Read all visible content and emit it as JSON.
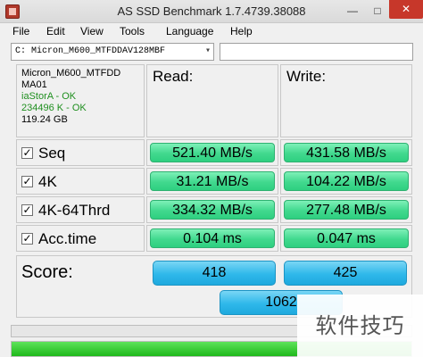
{
  "window": {
    "title": "AS SSD Benchmark 1.7.4739.38088",
    "minimize_glyph": "—",
    "maximize_glyph": "□",
    "close_glyph": "✕"
  },
  "menu": [
    "File",
    "Edit",
    "View",
    "Tools",
    "Language",
    "Help"
  ],
  "drive_select": {
    "value": "C: Micron_M600_MTFDDAV128MBF",
    "arrow": "▾"
  },
  "drive_info": {
    "model": "Micron_M600_MTFDD",
    "firmware": "MA01",
    "driver": "iaStorA - OK",
    "alignment": "234496 K - OK",
    "size": "119.24 GB"
  },
  "columns": {
    "read": "Read:",
    "write": "Write:"
  },
  "check_glyph": "✓",
  "rows": [
    {
      "label": "Seq",
      "read": "521.40 MB/s",
      "write": "431.58 MB/s"
    },
    {
      "label": "4K",
      "read": "31.21 MB/s",
      "write": "104.22 MB/s"
    },
    {
      "label": "4K-64Thrd",
      "read": "334.32 MB/s",
      "write": "277.48 MB/s"
    },
    {
      "label": "Acc.time",
      "read": "0.104 ms",
      "write": "0.047 ms"
    }
  ],
  "score": {
    "label": "Score:",
    "read": "418",
    "write": "425",
    "total": "1062"
  },
  "progress": {
    "fraction": 1.0,
    "fill_color": "#2fc72b"
  },
  "watermark": "软件技巧",
  "colors": {
    "result_green": "#41d98e",
    "score_blue": "#2fb8ea",
    "ok_green": "#1f8f1f",
    "close_red": "#c7372a"
  }
}
